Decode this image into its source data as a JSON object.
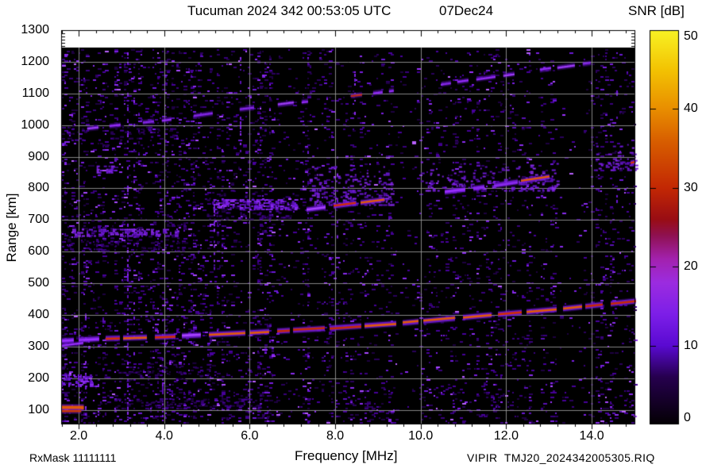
{
  "header": {
    "title": "Tucuman 2024 342 00:53:05 UTC",
    "date": "07Dec24"
  },
  "footer": {
    "rx_mask": "RxMask 11111111",
    "file_label": "VIPIR  TMJ20_2024342005305.RIQ"
  },
  "chart_data": {
    "type": "heatmap",
    "title": "Tucuman 2024 342 00:53:05 UTC   07Dec24",
    "xlabel": "Frequency [MHz]",
    "ylabel": "Range [km]",
    "xlim": [
      1.59,
      15.02
    ],
    "ylim": [
      54,
      1300
    ],
    "data_top_km": 1245,
    "x_ticks": {
      "values": [
        2,
        4,
        6,
        8,
        10,
        12,
        14
      ],
      "labels": [
        "2.0",
        "4.0",
        "6.0",
        "8.0",
        "10.0",
        "12.0",
        "14.0"
      ],
      "minor_step": 0.4
    },
    "y_ticks": {
      "values": [
        100,
        200,
        300,
        400,
        500,
        600,
        700,
        800,
        900,
        1000,
        1100,
        1200,
        1300
      ],
      "minor_step": 10
    },
    "grid": true,
    "grid_color": "rgba(158,158,158,0.85)",
    "colorbar": {
      "label": "SNR [dB]",
      "min": 0,
      "max": 50,
      "ticks": [
        0,
        10,
        20,
        30,
        40,
        50
      ],
      "stops": [
        [
          0,
          "#040004"
        ],
        [
          6,
          "#26004e"
        ],
        [
          10,
          "#5a0ad2"
        ],
        [
          14,
          "#7d1fe8"
        ],
        [
          18,
          "#9c2ce0"
        ],
        [
          21,
          "#a322ae"
        ],
        [
          24,
          "#8f1150"
        ],
        [
          26,
          "#990d14"
        ],
        [
          30,
          "#c32804"
        ],
        [
          36,
          "#d85f00"
        ],
        [
          40,
          "#e98e00"
        ],
        [
          45,
          "#f3c303"
        ],
        [
          50,
          "#f8f224"
        ]
      ]
    },
    "palettes": {
      "dim": [
        "#1d0040",
        "#2a005c",
        "#38007c",
        "#46009a"
      ],
      "mid": [
        "#5a10b4",
        "#6a18d4",
        "#7a1ee0",
        "#8a2bee"
      ],
      "bright": [
        "#8a2bee",
        "#9b30ff",
        "#a848ff",
        "#b860ff"
      ]
    },
    "noise": {
      "seed": 2024,
      "base_density": 0.085,
      "left_density": 0.14,
      "left_until_mhz": 7.4,
      "bottom_boost": 0.05,
      "bottom_below_km": 170,
      "col_mod_min": 0.35,
      "col_mod_max": 1.7,
      "mid_p": 0.2,
      "bright_p": 0.05
    },
    "dark_bands": [
      [
        6.53,
        7.22,
        0.3
      ],
      [
        9.39,
        9.97,
        0.3
      ],
      [
        13.16,
        13.94,
        0.35
      ],
      [
        10.4,
        10.55,
        0.5
      ]
    ],
    "rfi_columns": [
      {
        "f": 2.17,
        "r": [
          54,
          420
        ],
        "d": 0.3
      },
      {
        "f": 3.15,
        "r": [
          54,
          1245
        ],
        "d": 0.4
      },
      {
        "f": 3.3,
        "r": [
          260,
          1245
        ],
        "d": 0.18
      },
      {
        "f": 3.97,
        "r": [
          54,
          430
        ],
        "d": 0.3
      },
      {
        "f": 5.18,
        "r": [
          540,
          770
        ],
        "d": 0.4
      },
      {
        "f": 5.79,
        "r": [
          860,
          1245
        ],
        "d": 0.3
      },
      {
        "f": 8.05,
        "r": [
          640,
          900
        ],
        "d": 0.2
      },
      {
        "f": 8.46,
        "r": [
          1020,
          1245
        ],
        "d": 0.22
      },
      {
        "f": 14.6,
        "r": [
          700,
          1245
        ],
        "d": 0.15
      }
    ],
    "patches": [
      {
        "f": [
          1.74,
          4.5
        ],
        "r": [
          600,
          700
        ],
        "d": 0.22,
        "fade": true,
        "pal": "dim"
      },
      {
        "f": [
          1.85,
          4.35
        ],
        "r": [
          648,
          672
        ],
        "d": 0.5,
        "fade": false,
        "pal": "mid"
      },
      {
        "f": [
          5.0,
          7.1
        ],
        "r": [
          700,
          800
        ],
        "d": 0.22,
        "fade": true,
        "pal": "dim"
      },
      {
        "f": [
          5.15,
          7.05
        ],
        "r": [
          733,
          766
        ],
        "d": 0.5,
        "fade": false,
        "pal": "mid"
      },
      {
        "f": [
          7.4,
          9.3
        ],
        "r": [
          745,
          875
        ],
        "d": 0.4,
        "fade": true,
        "pal": "mid"
      },
      {
        "f": [
          10.0,
          13.2
        ],
        "r": [
          790,
          885
        ],
        "d": 0.32,
        "fade": true,
        "pal": "mid"
      },
      {
        "f": [
          14.05,
          15.02
        ],
        "r": [
          858,
          940
        ],
        "d": 0.38,
        "fade": true,
        "pal": "mid"
      },
      {
        "f": [
          2.85,
          6.3
        ],
        "r": [
          105,
          135
        ],
        "d": 0.2,
        "fade": false,
        "pal": "dim"
      },
      {
        "f": [
          2.6,
          5.1
        ],
        "r": [
          190,
          250
        ],
        "d": 0.12,
        "fade": false,
        "pal": "dim"
      },
      {
        "f": [
          1.59,
          2.3
        ],
        "r": [
          176,
          212
        ],
        "d": 0.6,
        "fade": false,
        "pal": "mid"
      },
      {
        "f": [
          2.42,
          2.8
        ],
        "r": [
          850,
          872
        ],
        "d": 0.55,
        "fade": false,
        "pal": "mid"
      },
      {
        "f": [
          1.74,
          4.2
        ],
        "r": [
          950,
          1000
        ],
        "d": 0.12,
        "fade": false,
        "pal": "dim"
      }
    ],
    "traces": [
      {
        "name": "F-region echo",
        "points": [
          [
            1.59,
            318
          ],
          [
            2.5,
            325
          ],
          [
            4,
            331
          ],
          [
            5.7,
            342
          ],
          [
            7.6,
            356
          ],
          [
            9.45,
            373
          ],
          [
            11.3,
            396
          ],
          [
            13.2,
            418
          ],
          [
            15.02,
            444
          ]
        ],
        "seg": 30,
        "gap": 6,
        "halo": "rgba(122,28,230,0.8)",
        "halo_h": 6,
        "core_h": 2.6,
        "hot": [
          [
            2.35,
            15.02
          ]
        ],
        "hot_p": 0.78,
        "hot_colors": [
          "#d22e02",
          "#e25b06",
          "#c62a04"
        ],
        "cool_colors": [
          "#9b30ff",
          "#a843ff"
        ],
        "gaps": []
      },
      {
        "name": "F-region echo left stub",
        "points": [
          [
            1.59,
            303
          ],
          [
            2.3,
            315
          ]
        ],
        "seg": 20,
        "gap": 8,
        "halo": "rgba(110,24,210,0.6)",
        "halo_h": 4,
        "core_h": 2,
        "hot": [],
        "hot_p": 0,
        "hot_colors": [],
        "cool_colors": [
          "#8a2bee",
          "#9b30ff"
        ],
        "gaps": []
      },
      {
        "name": "second-hop echo",
        "points": [
          [
            7.33,
            733
          ],
          [
            9.1,
            764
          ],
          [
            11.3,
            801
          ],
          [
            13,
            836
          ],
          [
            14.2,
            860
          ],
          [
            15.02,
            884
          ]
        ],
        "seg": 26,
        "gap": 7,
        "halo": "rgba(122,28,230,0.8)",
        "halo_h": 5.5,
        "core_h": 2.4,
        "hot": [
          [
            7.45,
            9.12
          ],
          [
            11.95,
            13
          ],
          [
            14.85,
            15.02
          ]
        ],
        "hot_p": 0.85,
        "hot_colors": [
          "#d22e02",
          "#e25b06"
        ],
        "cool_colors": [
          "#9b30ff",
          "#a843ff",
          "#8a2bee"
        ],
        "gaps": [
          [
            9.12,
            9.9
          ],
          [
            13,
            13.87
          ],
          [
            14.03,
            14.18
          ]
        ]
      },
      {
        "name": "upper multi-hop echo",
        "points": [
          [
            2.2,
            989
          ],
          [
            4,
            1016
          ],
          [
            5.73,
            1049
          ],
          [
            8.52,
            1095
          ],
          [
            10.56,
            1131
          ],
          [
            12.89,
            1176
          ],
          [
            13.95,
            1196
          ]
        ],
        "seg": 16,
        "gap": 10,
        "halo": "rgba(110,24,210,0.55)",
        "halo_h": 4.5,
        "core_h": 2.2,
        "hot": [
          [
            8.28,
            8.38
          ]
        ],
        "hot_p": 1,
        "hot_colors": [
          "#cc2e04"
        ],
        "cool_colors": [
          "#8a2bee",
          "#9b30ff",
          "#a843ff"
        ],
        "gaps": [
          [
            2.95,
            3.1
          ],
          [
            4.25,
            4.6
          ],
          [
            5.2,
            5.55
          ],
          [
            6.1,
            6.3
          ],
          [
            7.35,
            8.05
          ],
          [
            9.35,
            10.3
          ],
          [
            12.35,
            12.55
          ]
        ]
      }
    ],
    "ground_echoes": [
      {
        "f": [
          1.59,
          2.12
        ],
        "r": 107,
        "h": 4.5,
        "core": "#e05a06",
        "halo": "rgba(138,30,224,0.6)"
      },
      {
        "f": [
          1.59,
          2.06
        ],
        "r": 96,
        "h": 2.5,
        "core": "#cc3a04",
        "halo": "rgba(122,26,200,0.5)"
      }
    ]
  }
}
